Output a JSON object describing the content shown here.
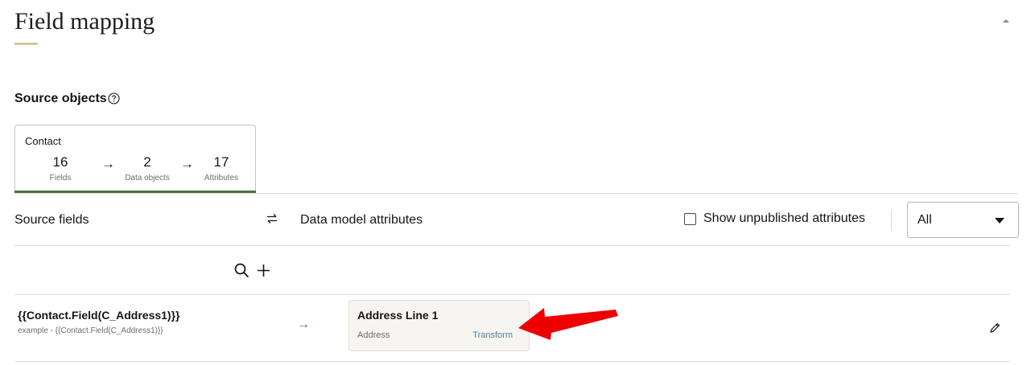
{
  "page": {
    "title": "Field mapping"
  },
  "source_objects": {
    "label": "Source objects",
    "card": {
      "name": "Contact",
      "fields_count": "16",
      "fields_label": "Fields",
      "data_objects_count": "2",
      "data_objects_label": "Data objects",
      "attributes_count": "17",
      "attributes_label": "Attributes",
      "arrow": "→"
    }
  },
  "mapping_header": {
    "source_fields_label": "Source fields",
    "data_model_attributes_label": "Data model attributes",
    "show_unpublished_label": "Show unpublished attributes",
    "filter_value": "All"
  },
  "mappings": [
    {
      "source_field": "{{Contact.Field(C_Address1)}}",
      "example": "example - {{Contact.Field(C_Address1)}}",
      "arrow": "→",
      "attribute_name": "Address Line 1",
      "attribute_type": "Address",
      "transform_label": "Transform"
    }
  ],
  "colors": {
    "accent_underline": "#d8c49a",
    "card_active_bar": "#4e6f45",
    "mapping_arrow": "#3d7a3a",
    "transform_link": "#4d7f9b",
    "annotation_arrow": "#ee0000"
  },
  "icons": {
    "collapse": "chevron-up-icon",
    "help": "question-circle-icon",
    "swap": "swap-arrows-icon",
    "search": "search-icon",
    "add": "plus-icon",
    "edit": "pencil-icon",
    "annotation": "red-arrow-icon"
  }
}
